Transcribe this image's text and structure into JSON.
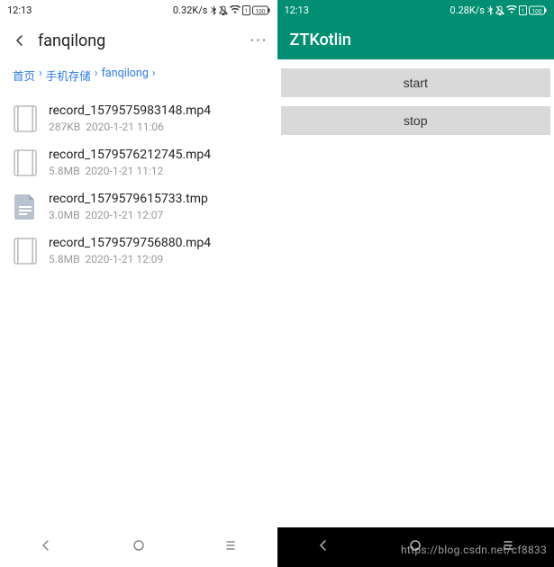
{
  "left": {
    "status": {
      "time": "12:13",
      "net": "0.32K/s"
    },
    "header": {
      "title": "fanqilong"
    },
    "breadcrumb": [
      {
        "label": "首页"
      },
      {
        "label": "手机存储"
      },
      {
        "label": "fanqilong"
      }
    ],
    "files": [
      {
        "name": "record_1579575983148.mp4",
        "size": "287KB",
        "date": "2020-1-21 11:06",
        "kind": "video"
      },
      {
        "name": "record_1579576212745.mp4",
        "size": "5.8MB",
        "date": "2020-1-21 11:12",
        "kind": "video"
      },
      {
        "name": "record_1579579615733.tmp",
        "size": "3.0MB",
        "date": "2020-1-21 12:07",
        "kind": "tmp"
      },
      {
        "name": "record_1579579756880.mp4",
        "size": "5.8MB",
        "date": "2020-1-21 12:09",
        "kind": "video"
      }
    ]
  },
  "right": {
    "status": {
      "time": "12:13",
      "net": "0.28K/s"
    },
    "app_title": "ZTKotlin",
    "buttons": {
      "start": "start",
      "stop": "stop"
    }
  },
  "watermark": "https://blog.csdn.net/cf8833"
}
